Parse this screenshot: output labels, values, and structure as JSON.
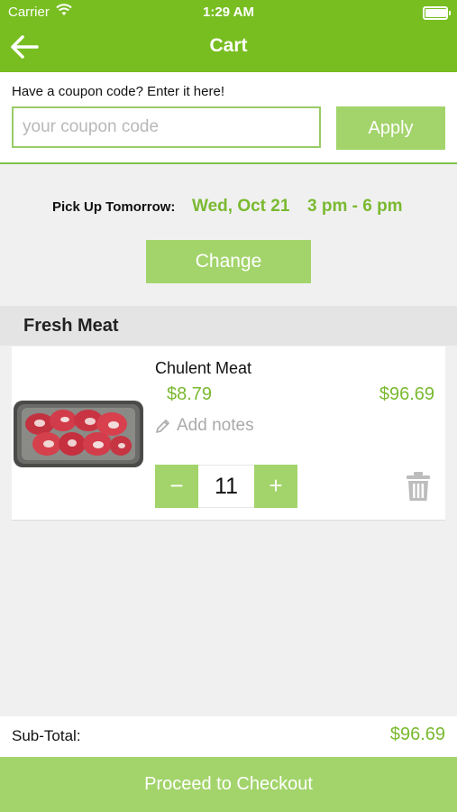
{
  "status_bar": {
    "carrier": "Carrier",
    "time": "1:29 AM",
    "battery_level": 0.95
  },
  "header": {
    "title": "Cart",
    "back_icon": "arrow-left-icon"
  },
  "coupon": {
    "label": "Have a coupon code? Enter it here!",
    "placeholder": "your coupon code",
    "value": "",
    "apply_label": "Apply"
  },
  "pickup": {
    "label": "Pick Up Tomorrow:",
    "date": "Wed, Oct 21",
    "time": "3 pm - 6 pm",
    "change_label": "Change"
  },
  "section": {
    "title": "Fresh Meat"
  },
  "items": [
    {
      "name": "Chulent Meat",
      "unit_price": "$8.79",
      "line_total": "$96.69",
      "notes_placeholder": "Add notes",
      "quantity": "11",
      "minus_label": "−",
      "plus_label": "+",
      "image": "raw-beef-tray",
      "notes_icon": "pencil-icon",
      "delete_icon": "trash-icon"
    }
  ],
  "footer": {
    "subtotal_label": "Sub-Total:",
    "subtotal_value": "$96.69",
    "checkout_label": "Proceed to Checkout"
  },
  "colors": {
    "nav_green": "#78be21",
    "button_green": "#a3d46b",
    "price_green": "#7ab930",
    "background": "#f0f0f0"
  }
}
